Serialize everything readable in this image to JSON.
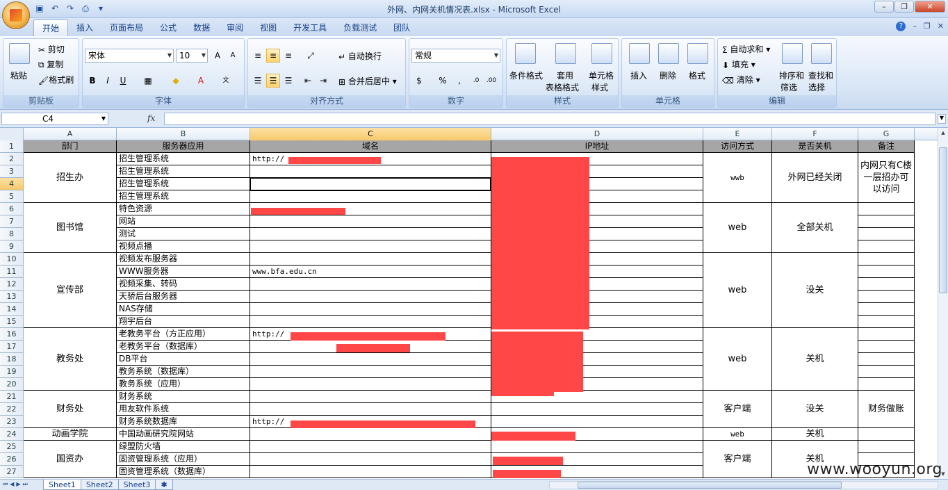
{
  "window": {
    "title": "外网、内网关机情况表.xlsx - Microsoft Excel"
  },
  "ribbon_tabs": [
    "开始",
    "插入",
    "页面布局",
    "公式",
    "数据",
    "审阅",
    "视图",
    "开发工具",
    "负载测试",
    "团队"
  ],
  "ribbon": {
    "clipboard": {
      "paste": "粘贴",
      "cut": "剪切",
      "copy": "复制",
      "format_painter": "格式刷",
      "label": "剪贴板"
    },
    "font": {
      "name": "宋体",
      "size": "10",
      "label": "字体"
    },
    "alignment": {
      "wrap": "自动换行",
      "merge": "合并后居中",
      "label": "对齐方式"
    },
    "number": {
      "format": "常规",
      "label": "数字"
    },
    "styles": {
      "cond": "条件格式",
      "table_1": "套用",
      "table_2": "表格格式",
      "cell_1": "单元格",
      "cell_2": "样式",
      "label": "样式"
    },
    "cells": {
      "insert": "插入",
      "delete": "删除",
      "format": "格式",
      "label": "单元格"
    },
    "editing": {
      "autosum": "自动求和",
      "fill": "填充",
      "clear": "清除",
      "sort_1": "排序和",
      "sort_2": "筛选",
      "find_1": "查找和",
      "find_2": "选择",
      "label": "编辑"
    }
  },
  "formula_bar": {
    "name_box": "C4",
    "value": ""
  },
  "columns": [
    "A",
    "B",
    "C",
    "D",
    "E",
    "F",
    "G"
  ],
  "rows": [
    "1",
    "2",
    "3",
    "4",
    "5",
    "6",
    "7",
    "8",
    "9",
    "10",
    "11",
    "12",
    "13",
    "14",
    "15",
    "16",
    "17",
    "18",
    "19",
    "20",
    "21",
    "22",
    "23",
    "24",
    "25",
    "26",
    "27"
  ],
  "headers": {
    "a": "部门",
    "b": "服务器应用",
    "c": "域名",
    "d": "IP地址",
    "e": "访问方式",
    "f": "是否关机",
    "g": "备注"
  },
  "departments": [
    "招生办",
    "图书馆",
    "宣传部",
    "教务处",
    "财务处",
    "动画学院",
    "国资办"
  ],
  "apps": [
    "招生管理系统",
    "招生管理系统",
    "招生管理系统",
    "招生管理系统",
    "特色资源",
    "网站",
    "测试",
    "视频点播",
    "视频发布服务器",
    "WWW服务器",
    "视频采集、转码",
    "天骄后台服务器",
    "NAS存储",
    "翔宇后台",
    "老教务平台（方正应用）",
    "老教务平台（数据库）",
    "DB平台",
    "教务系统（数据库）",
    "教务系统（应用）",
    "财务系统",
    "用友软件系统",
    "财务系统数据库",
    "中国动画研究院网站",
    "绿盟防火墙",
    "固资管理系统（应用）",
    "固资管理系统（数据库）"
  ],
  "domains": {
    "r2": "http://",
    "r11": "www.bfa.edu.cn",
    "r16": "http://",
    "r23": "http://"
  },
  "access": [
    "wwb",
    "web",
    "web",
    "web",
    "客户端",
    "web",
    "客户端"
  ],
  "shutdown": [
    "外网已经关闭",
    "全部关机",
    "没关",
    "关机",
    "没关",
    "关机",
    "关机"
  ],
  "notes": {
    "zsb": "内网只有C楼一层招办可以访问",
    "cwc": "财务做账"
  },
  "sheet_tabs": [
    "Sheet1",
    "Sheet2",
    "Sheet3"
  ],
  "watermark": "www.wooyun.org",
  "colors": {
    "redaction": "#ff4747",
    "header_fill": "#a6a6a6",
    "active_header": "#f8c96b"
  }
}
